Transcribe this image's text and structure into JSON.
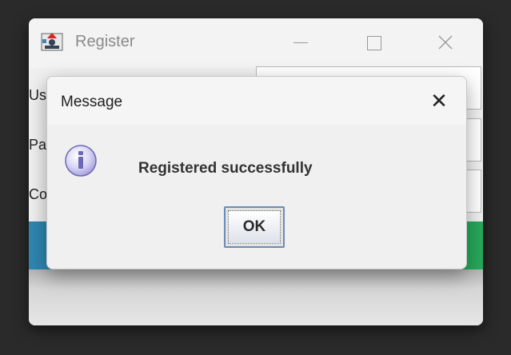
{
  "register_window": {
    "title": "Register",
    "labels": [
      "Us",
      "Pa",
      "Co"
    ],
    "controls": {
      "minimize": "minimize",
      "maximize": "maximize",
      "close": "close"
    }
  },
  "message_dialog": {
    "title": "Message",
    "text": "Registered successfully",
    "ok_label": "OK",
    "close_glyph": "✕",
    "icon": "info-icon"
  },
  "colors": {
    "gradient_start": "#2e86b0",
    "gradient_end": "#27a85a",
    "dialog_bg": "#f0f0f0"
  }
}
